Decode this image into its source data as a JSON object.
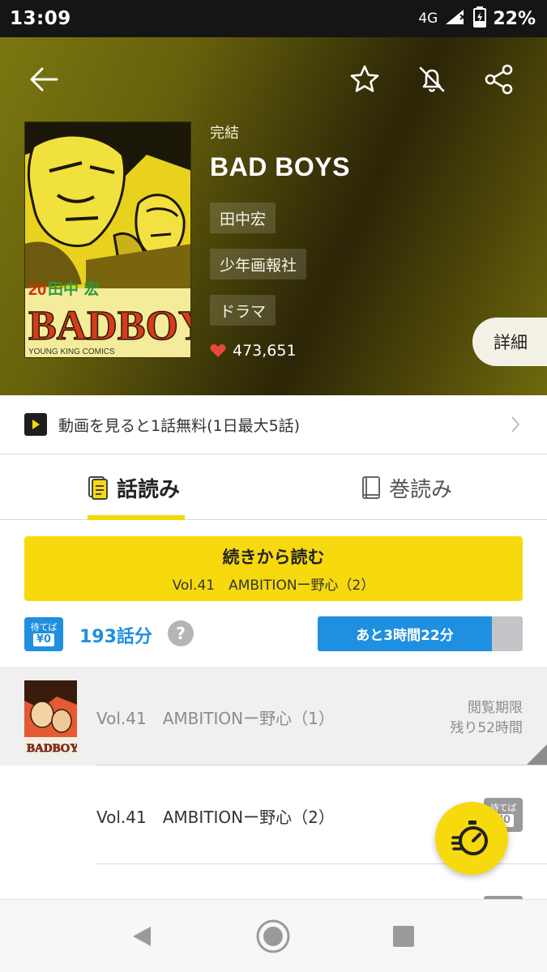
{
  "status_bar": {
    "time": "13:09",
    "network": "4G",
    "battery": "22%"
  },
  "header": {
    "icons": [
      "back-arrow-icon",
      "star-icon",
      "bell-off-icon",
      "share-icon"
    ]
  },
  "manga": {
    "status": "完結",
    "title": "BAD BOYS",
    "author": "田中宏",
    "publisher": "少年画報社",
    "genre": "ドラマ",
    "likes": "473,651",
    "detail_label": "詳細",
    "cover": {
      "volume": "20",
      "author": "田中 宏",
      "logo": "BAD BOYS",
      "imprint": "YOUNG KING COMICS"
    }
  },
  "banner": {
    "text": "動画を見ると1話無料(1日最大5話)"
  },
  "tabs": [
    {
      "label": "話読み",
      "active": true
    },
    {
      "label": "巻読み",
      "active": false
    }
  ],
  "continue": {
    "label": "続きから読む",
    "episode": "Vol.41　AMBITIONー野心（2）"
  },
  "free_wait": {
    "badge_top": "待てば",
    "badge_bottom": "¥0",
    "count": "193話分",
    "help": "?",
    "timer_text": "あと3時間22分",
    "timer_progress": 0.85
  },
  "episodes": [
    {
      "title": "Vol.41　AMBITIONー野心（1）",
      "expire_line1": "閲覧期限",
      "expire_line2": "残り52時間",
      "read": true
    },
    {
      "title": "Vol.41　AMBITIONー野心（2）",
      "badge_top": "待てば",
      "badge_bottom": "¥0"
    }
  ],
  "colors": {
    "accent": "#f7da0e",
    "blue": "#1f8fe0",
    "heart": "#e8473b"
  }
}
